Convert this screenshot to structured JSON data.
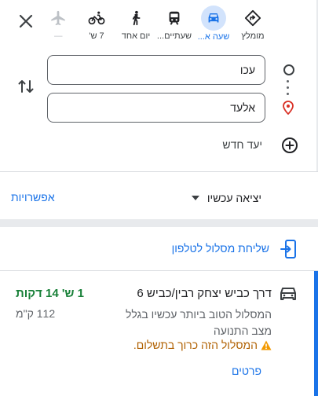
{
  "travel_modes": [
    {
      "label": "מומלץ",
      "icon": "diamond-directions-icon"
    },
    {
      "label": "שעה א...",
      "icon": "car-icon",
      "selected": true
    },
    {
      "label": "שעתיים...",
      "icon": "train-icon"
    },
    {
      "label": "יום אחד",
      "icon": "walk-icon"
    },
    {
      "label": "7 ש'",
      "icon": "bike-icon"
    },
    {
      "label": "—",
      "icon": "plane-icon"
    }
  ],
  "route": {
    "origin": "עכו",
    "destination": "אלעד",
    "add_destination": "יעד חדש"
  },
  "options": {
    "depart_label": "יציאה עכשיו",
    "options_link": "אפשרויות"
  },
  "send_to_phone": "שליחת מסלול לטלפון",
  "result": {
    "title": "דרך כביש יצחק רבין/כביש 6",
    "duration": "1 ש' 14 דקות",
    "distance": "112 ק\"מ",
    "description": "המסלול הטוב ביותר עכשיו בגלל מצב התנועה",
    "warning": "המסלול הזה כרוך בתשלום.",
    "details_link": "פרטים"
  },
  "colors": {
    "accent": "#1a73e8",
    "duration_green": "#188038",
    "warning_orange": "#b06000",
    "warning_icon": "#f29900",
    "destination_pin": "#d93025"
  }
}
